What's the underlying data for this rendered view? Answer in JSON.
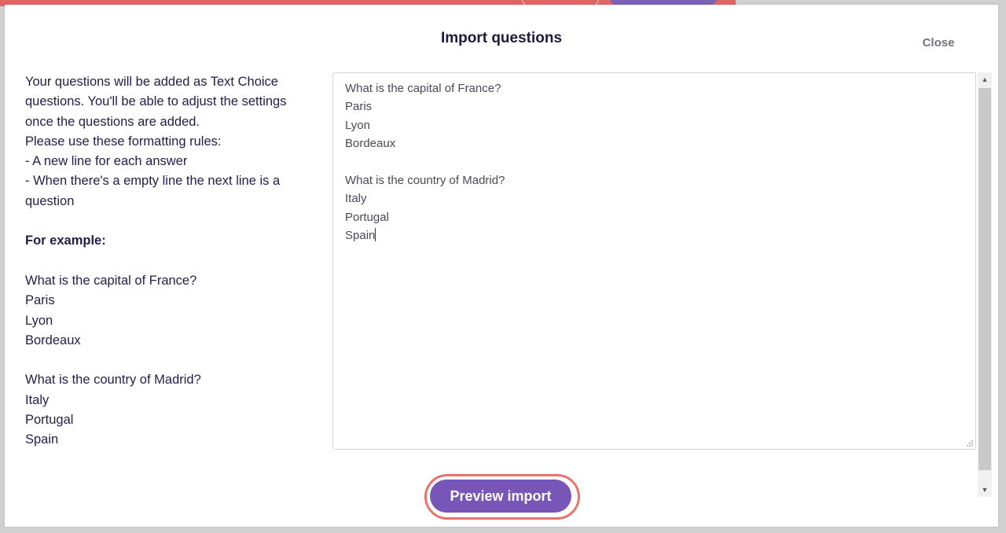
{
  "modal": {
    "title": "Import questions",
    "close_label": "Close"
  },
  "instructions": {
    "lines": [
      "Your questions will be added as Text Choice",
      "questions. You'll be able to adjust the settings",
      "once the questions are added.",
      "Please use these formatting rules:",
      "- A new line for each answer",
      "- When there's a empty line the next line is a",
      "question",
      "",
      "",
      "",
      "What is the capital of France?",
      "Paris",
      "Lyon",
      "Bordeaux",
      "",
      "What is the country of Madrid?",
      "Italy",
      "Portugal",
      "Spain"
    ],
    "example_heading": "For example:"
  },
  "textarea": {
    "lines": [
      "What is the capital of France?",
      "Paris",
      "Lyon",
      "Bordeaux",
      "",
      "What is the country of Madrid?",
      "Italy",
      "Portugal",
      "Spain"
    ]
  },
  "actions": {
    "preview_label": "Preview import"
  },
  "colors": {
    "accent": "#7856b8",
    "highlight": "#e8736b",
    "title_text": "#1e1a3d"
  }
}
